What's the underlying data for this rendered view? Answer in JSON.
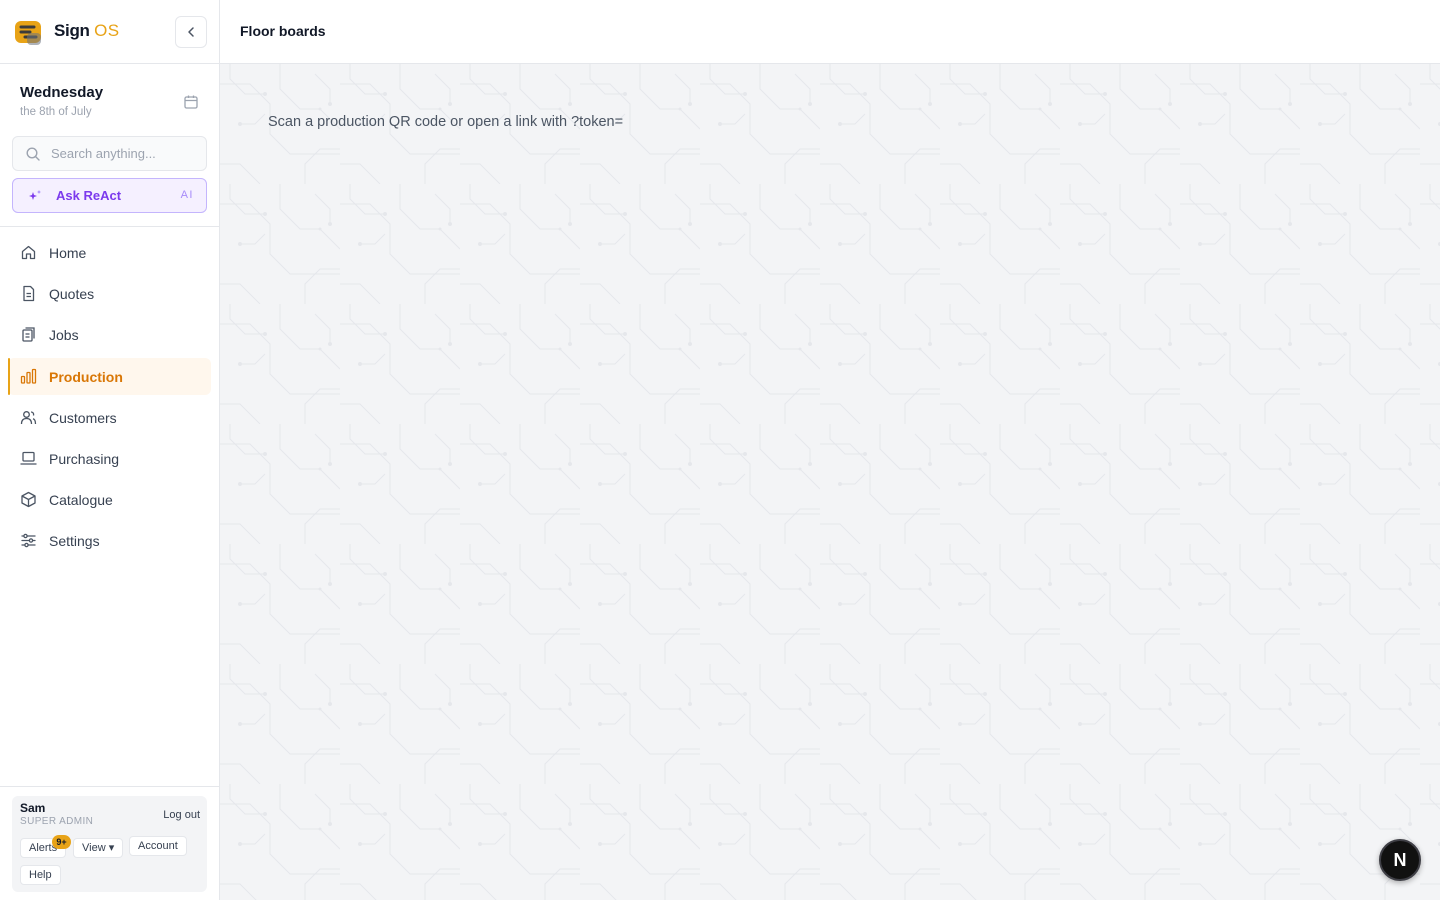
{
  "brand": {
    "name": "Sign",
    "suffix": "OS"
  },
  "date": {
    "day": "Wednesday",
    "detail": "the 8th of July"
  },
  "search": {
    "placeholder": "Search anything..."
  },
  "ask": {
    "label": "Ask ReAct",
    "tag": "AI"
  },
  "nav": [
    {
      "label": "Home",
      "icon": "home-icon"
    },
    {
      "label": "Quotes",
      "icon": "document-icon"
    },
    {
      "label": "Jobs",
      "icon": "jobs-icon"
    },
    {
      "label": "Production",
      "icon": "bar-chart-icon",
      "active": true
    },
    {
      "label": "Customers",
      "icon": "users-icon"
    },
    {
      "label": "Purchasing",
      "icon": "laptop-icon"
    },
    {
      "label": "Catalogue",
      "icon": "box-icon"
    },
    {
      "label": "Settings",
      "icon": "sliders-icon"
    }
  ],
  "user": {
    "name": "Sam",
    "role": "SUPER ADMIN",
    "logout_label": "Log out",
    "alerts_label": "Alerts",
    "alerts_badge": "9+",
    "view_label": "View ▾",
    "account_label": "Account",
    "help_label": "Help"
  },
  "header": {
    "title": "Floor boards"
  },
  "main": {
    "message": "Scan a production QR code or open a link with ?token="
  },
  "fab": {
    "label": "N"
  },
  "colors": {
    "accent": "#e8a317",
    "ai": "#7c3aed",
    "active_bg": "#fff7ed"
  }
}
